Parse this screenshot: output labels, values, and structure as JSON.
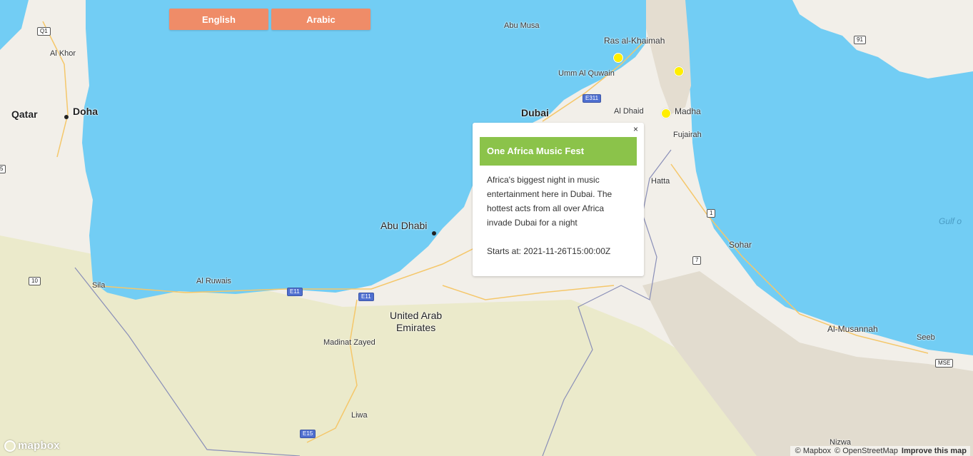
{
  "buttons": {
    "english": "English",
    "arabic": "Arabic"
  },
  "colors": {
    "water": "#72cdf4",
    "land": "#f2efe9",
    "desert": "#ebeacb",
    "button": "#ef8c68",
    "popup_header": "#8bc34a",
    "marker": "#ffee00"
  },
  "labels": {
    "qatar": "Qatar",
    "doha": "Doha",
    "al_khor": "Al Khor",
    "abu_musa": "Abu Musa",
    "ras_al_khaimah": "Ras al-Khaimah",
    "umm_al_quwain": "Umm Al Quwain",
    "dubai": "Dubai",
    "al_dhaid": "Al Dhaid",
    "madha": "Madha",
    "fujairah": "Fujairah",
    "hatta": "Hatta",
    "abu_dhabi": "Abu Dhabi",
    "sila": "Sila",
    "al_ruwais": "Al Ruwais",
    "uae_line1": "United Arab",
    "uae_line2": "Emirates",
    "madinat_zayed": "Madinat Zayed",
    "liwa": "Liwa",
    "sohar": "Sohar",
    "al_musannah": "Al-Musannah",
    "seeb": "Seeb",
    "nizwa": "Nizwa",
    "gulf": "Gulf o"
  },
  "shields": {
    "q1": "Q1",
    "r91": "91",
    "e311": "E311",
    "e11a": "E11",
    "e11b": "E11",
    "r10": "10",
    "r1": "1",
    "r7": "7",
    "e15": "E15",
    "mse": "MSE",
    "r5": "5"
  },
  "markers": [
    {
      "name": "marker-ras-al-khaimah"
    },
    {
      "name": "marker-east-coast"
    },
    {
      "name": "marker-madha"
    }
  ],
  "popup": {
    "close": "×",
    "title": "One Africa Music Fest",
    "description": "Africa's biggest night in music entertainment here in Dubai. The hottest acts from all over Africa invade Dubai for a night",
    "start": "Starts at: 2021-11-26T15:00:00Z"
  },
  "attribution": {
    "mapbox": "© Mapbox",
    "osm": "© OpenStreetMap",
    "improve": "Improve this map"
  },
  "logo": "mapbox"
}
